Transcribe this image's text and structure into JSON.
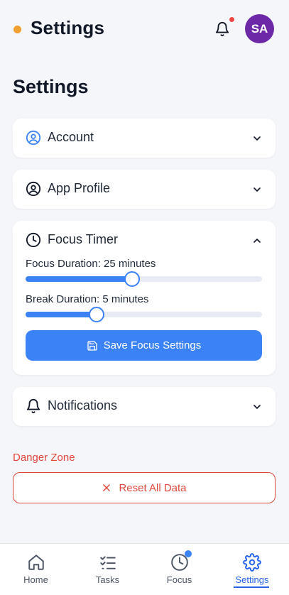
{
  "header": {
    "title": "Settings",
    "avatar_initials": "SA",
    "icons": [
      "status-dot",
      "bell-icon"
    ]
  },
  "page": {
    "title": "Settings"
  },
  "sections": {
    "account": {
      "label": "Account",
      "icon": "user-circle-icon",
      "expanded": false
    },
    "app_profile": {
      "label": "App Profile",
      "icon": "profile-icon",
      "expanded": false
    },
    "focus_timer": {
      "label": "Focus Timer",
      "icon": "clock-icon",
      "expanded": true,
      "focus_label": "Focus Duration: 25 minutes",
      "focus_value": 25,
      "focus_fill_fraction": 0.45,
      "break_label": "Break Duration: 5 minutes",
      "break_value": 5,
      "break_fill_fraction": 0.3,
      "save_label": "Save Focus Settings"
    },
    "notifications": {
      "label": "Notifications",
      "icon": "bell-icon",
      "expanded": false
    }
  },
  "danger_zone": {
    "title": "Danger Zone",
    "reset_label": "Reset All Data"
  },
  "bottom_nav": {
    "items": [
      {
        "label": "Home",
        "icon": "home-icon"
      },
      {
        "label": "Tasks",
        "icon": "checklist-icon"
      },
      {
        "label": "Focus",
        "icon": "clock-icon",
        "badge": true
      },
      {
        "label": "Settings",
        "icon": "gear-icon",
        "active": true
      }
    ]
  },
  "colors": {
    "accent": "#3b82f6",
    "danger": "#e0473c",
    "avatar": "#6d28a8",
    "status_dot": "#f0a030",
    "notification_badge": "#ef4444"
  }
}
